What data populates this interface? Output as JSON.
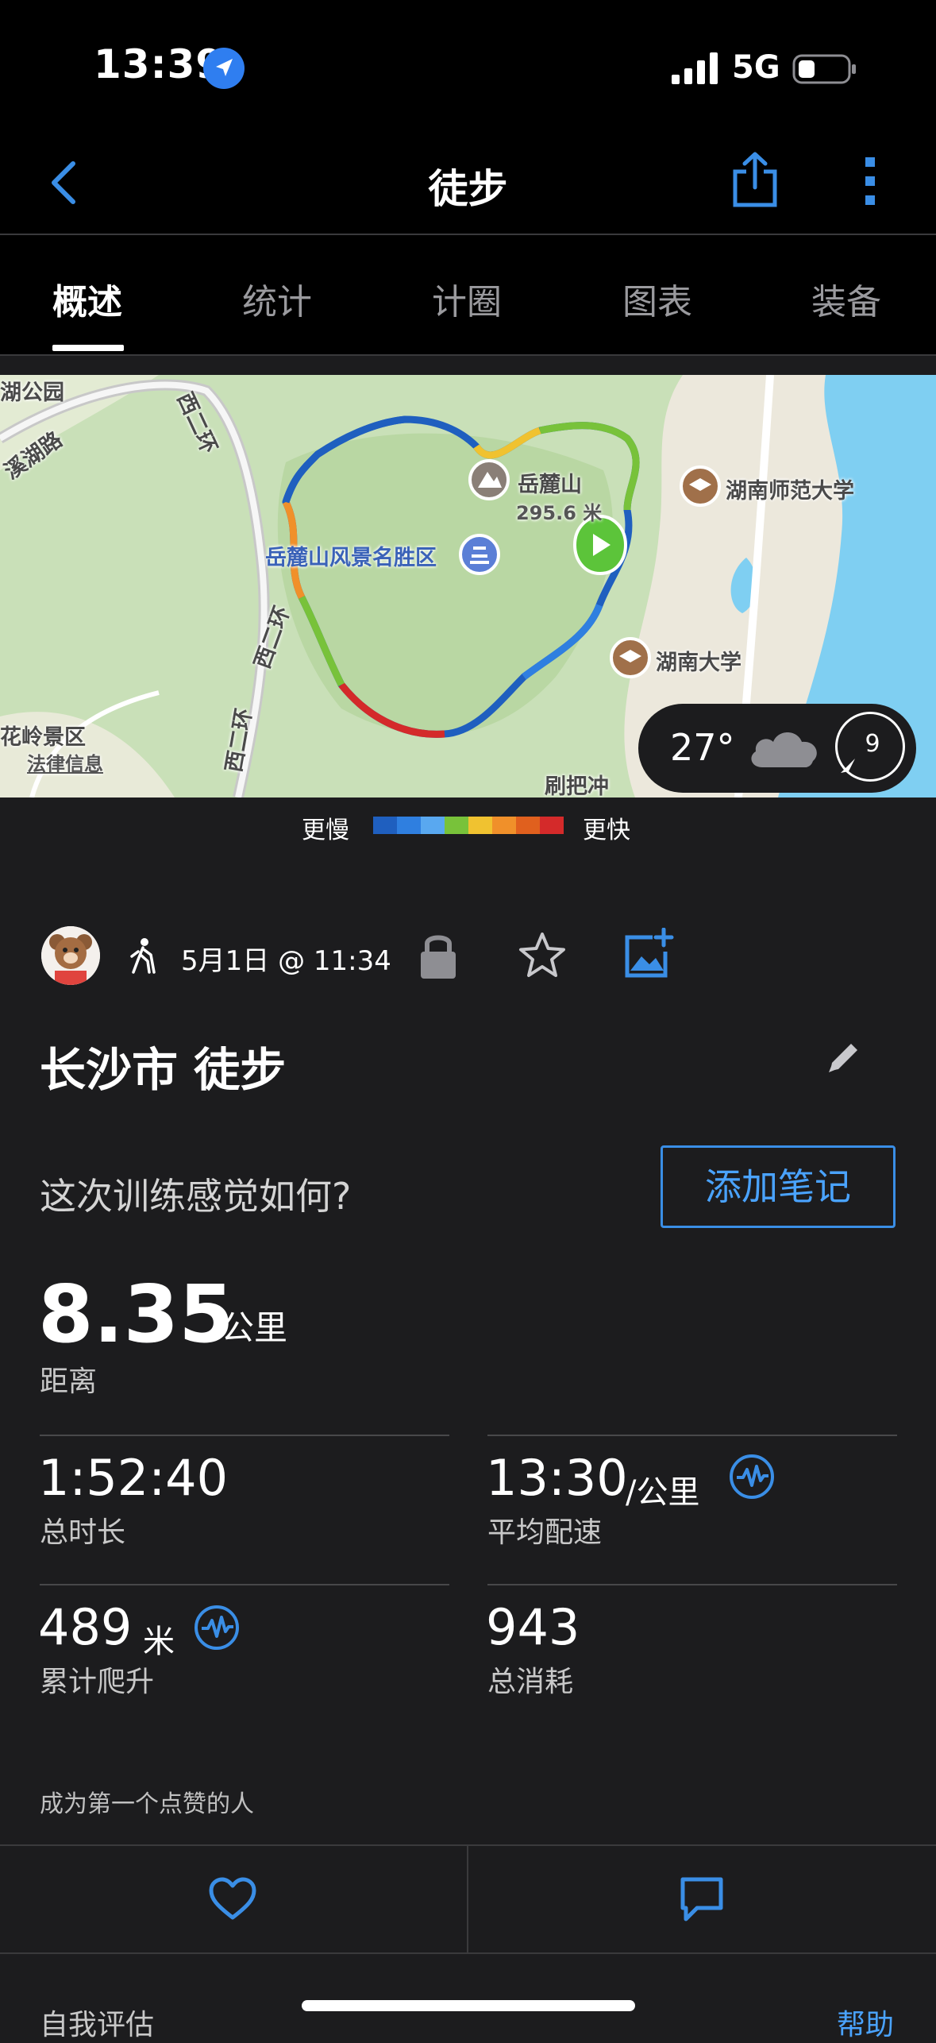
{
  "status_bar": {
    "time": "13:39",
    "network": "5G"
  },
  "nav": {
    "title": "徒步"
  },
  "tabs": [
    {
      "label": "概述",
      "active": true
    },
    {
      "label": "统计",
      "active": false
    },
    {
      "label": "计圈",
      "active": false
    },
    {
      "label": "图表",
      "active": false
    },
    {
      "label": "装备",
      "active": false
    }
  ],
  "map": {
    "labels": {
      "park_top": "湖公园",
      "road_lake": "溪湖路",
      "road_west_1": "西二环",
      "road_west_2": "西二环",
      "road_west_3": "西二环",
      "peak_name": "岳麓山",
      "peak_height": "295.6 米",
      "scenic_area": "岳麓山风景名胜区",
      "normal_univ": "湖南师范大学",
      "hunan_univ": "湖南大学",
      "huaan_area": "花岭景区",
      "legal_info": "法律信息",
      "shuabachong": "刷把冲"
    },
    "weather": {
      "temperature": "27°",
      "wind": "9",
      "icon": "cloud-icon"
    }
  },
  "legend": {
    "slower": "更慢",
    "faster": "更快",
    "colors": [
      "#1f5fbf",
      "#2f7fe0",
      "#59a8f0",
      "#78c23a",
      "#f0c230",
      "#f0902a",
      "#e0601e",
      "#d42a2a"
    ]
  },
  "activity": {
    "date": "5月1日 @ 11:34",
    "title": "长沙市 徒步",
    "feel_question": "这次训练感觉如何?",
    "add_note": "添加笔记"
  },
  "distance": {
    "value": "8.35",
    "unit": "公里",
    "label": "距离"
  },
  "stats": {
    "total_time": {
      "value": "1:52:40",
      "label": "总时长"
    },
    "avg_pace": {
      "value": "13:30",
      "unit": "/公里",
      "label": "平均配速"
    },
    "elevation_gain": {
      "value": "489",
      "unit": "米",
      "label": "累计爬升"
    },
    "calories": {
      "value": "943",
      "label": "总消耗"
    }
  },
  "social": {
    "like_prompt": "成为第一个点赞的人"
  },
  "footer": {
    "self_eval": "自我评估",
    "help": "帮助"
  },
  "colors": {
    "accent": "#3a8ee6",
    "background": "#1c1c1e",
    "chrome": "#000000"
  }
}
